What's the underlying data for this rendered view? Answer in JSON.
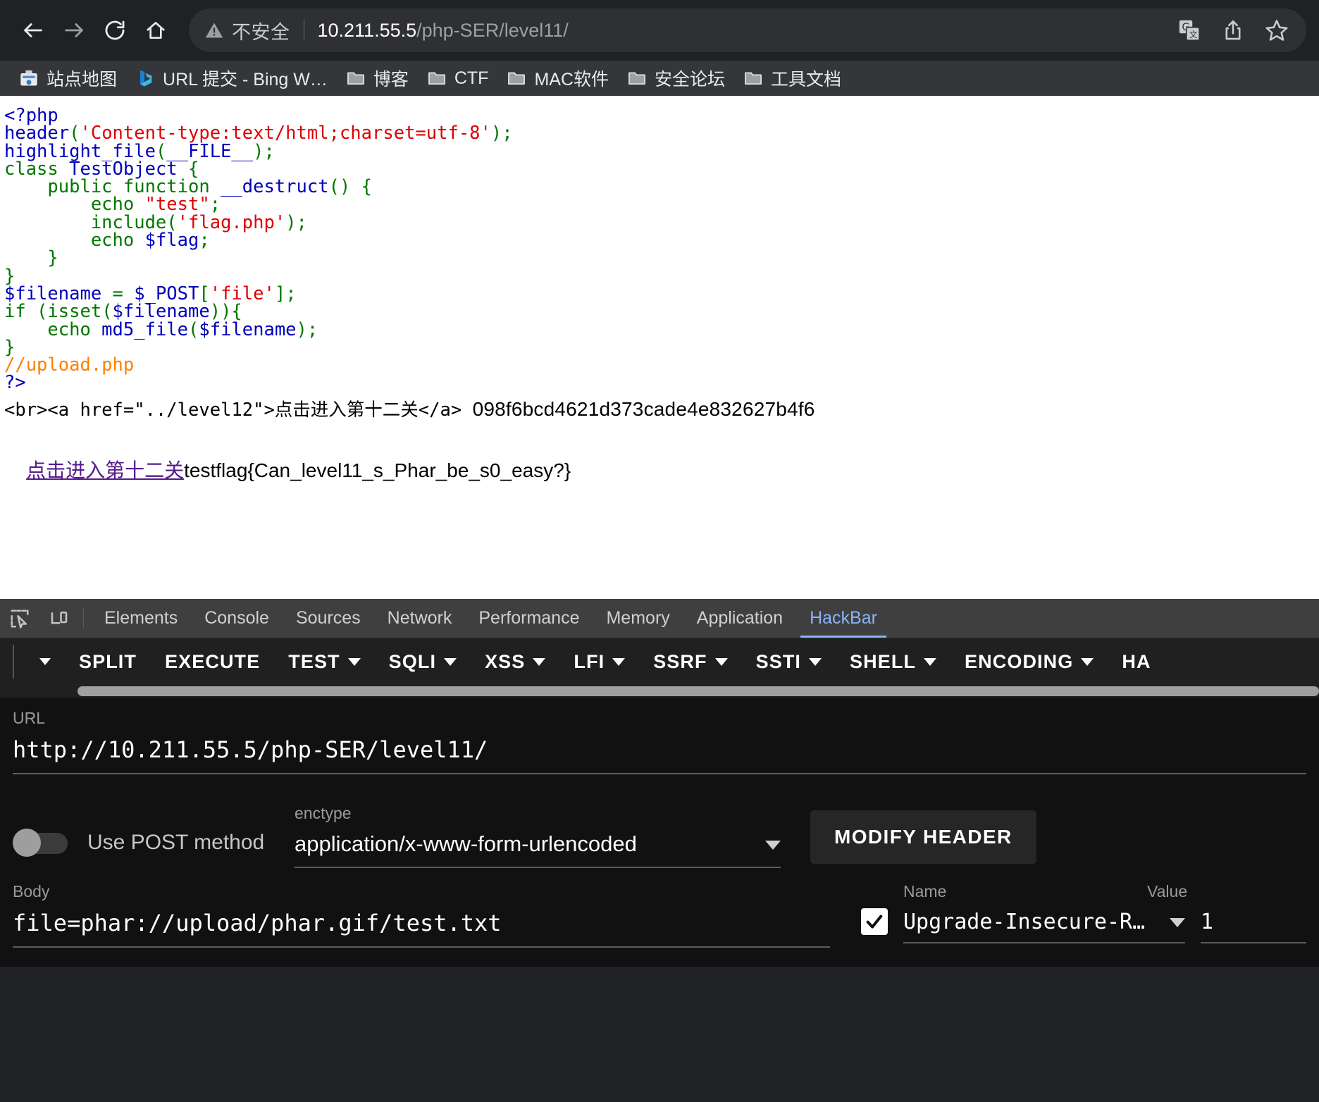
{
  "browser": {
    "nav": {
      "back": "back-arrow",
      "forward": "forward-arrow",
      "reload": "reload-arrow",
      "home": "home-house"
    },
    "omnibox": {
      "security_label": "不安全",
      "url_host": "10.211.55.5",
      "url_path": "/php-SER/level11/",
      "full_url": "10.211.55.5/php-SER/level11/",
      "actions": [
        "translate-icon",
        "share-icon",
        "bookmark-star-icon"
      ]
    },
    "bookmarks": [
      {
        "label": "站点地图",
        "icon": "sitemap-favicon"
      },
      {
        "label": "URL 提交 - Bing W…",
        "icon": "bing-favicon"
      },
      {
        "label": "博客",
        "icon": "folder-icon"
      },
      {
        "label": "CTF",
        "icon": "folder-icon"
      },
      {
        "label": "MAC软件",
        "icon": "folder-icon"
      },
      {
        "label": "安全论坛",
        "icon": "folder-icon"
      },
      {
        "label": "工具文档",
        "icon": "folder-icon"
      }
    ]
  },
  "page": {
    "source_lines": [
      [
        {
          "t": "<?php",
          "c": "d"
        }
      ],
      [
        {
          "t": "header",
          "c": "d"
        },
        {
          "t": "(",
          "c": "k"
        },
        {
          "t": "'Content-type:text/html;charset=utf-8'",
          "c": "s"
        },
        {
          "t": ");",
          "c": "k"
        }
      ],
      [
        {
          "t": "highlight_file",
          "c": "d"
        },
        {
          "t": "(",
          "c": "k"
        },
        {
          "t": "__FILE__",
          "c": "d"
        },
        {
          "t": ");",
          "c": "k"
        }
      ],
      [
        {
          "t": "class ",
          "c": "k"
        },
        {
          "t": "TestObject",
          "c": "d"
        },
        {
          "t": " {",
          "c": "k"
        }
      ],
      [
        {
          "t": "    public function ",
          "c": "k"
        },
        {
          "t": "__destruct",
          "c": "d"
        },
        {
          "t": "() {",
          "c": "k"
        }
      ],
      [
        {
          "t": "        echo ",
          "c": "k"
        },
        {
          "t": "\"test\"",
          "c": "s"
        },
        {
          "t": ";",
          "c": "k"
        }
      ],
      [
        {
          "t": "        include",
          "c": "k"
        },
        {
          "t": "(",
          "c": "k"
        },
        {
          "t": "'flag.php'",
          "c": "s"
        },
        {
          "t": ");",
          "c": "k"
        }
      ],
      [
        {
          "t": "        echo ",
          "c": "k"
        },
        {
          "t": "$flag",
          "c": "d"
        },
        {
          "t": ";",
          "c": "k"
        }
      ],
      [
        {
          "t": "    }",
          "c": "k"
        }
      ],
      [
        {
          "t": "}",
          "c": "k"
        }
      ],
      [
        {
          "t": "$filename",
          "c": "d"
        },
        {
          "t": " = ",
          "c": "k"
        },
        {
          "t": "$_POST",
          "c": "d"
        },
        {
          "t": "[",
          "c": "k"
        },
        {
          "t": "'file'",
          "c": "s"
        },
        {
          "t": "];",
          "c": "k"
        }
      ],
      [
        {
          "t": "if ",
          "c": "k"
        },
        {
          "t": "(",
          "c": "k"
        },
        {
          "t": "isset",
          "c": "k"
        },
        {
          "t": "(",
          "c": "k"
        },
        {
          "t": "$filename",
          "c": "d"
        },
        {
          "t": ")){",
          "c": "k"
        }
      ],
      [
        {
          "t": "    echo ",
          "c": "k"
        },
        {
          "t": "md5_file",
          "c": "d"
        },
        {
          "t": "(",
          "c": "k"
        },
        {
          "t": "$filename",
          "c": "d"
        },
        {
          "t": ");",
          "c": "k"
        }
      ],
      [
        {
          "t": "}",
          "c": "k"
        }
      ],
      [
        {
          "t": "//upload.php",
          "c": "c"
        }
      ],
      [
        {
          "t": "?>",
          "c": "d"
        }
      ]
    ],
    "output_raw_html": "<br><a href=\"../level12\">点击进入第十二关</a>",
    "output_md5": "098f6bcd4621d373cade4e832627b4f6",
    "output_link_text": "点击进入第十二关",
    "output_flag": "testflag{Can_level11_s_Phar_be_s0_easy?}"
  },
  "devtools": {
    "icons": [
      "inspect-element-icon",
      "device-toolbar-icon"
    ],
    "tabs": [
      {
        "label": "Elements",
        "active": false
      },
      {
        "label": "Console",
        "active": false
      },
      {
        "label": "Sources",
        "active": false
      },
      {
        "label": "Network",
        "active": false
      },
      {
        "label": "Performance",
        "active": false
      },
      {
        "label": "Memory",
        "active": false
      },
      {
        "label": "Application",
        "active": false
      },
      {
        "label": "HackBar",
        "active": true
      }
    ]
  },
  "hackbar": {
    "toolbar": [
      {
        "label": "",
        "caret": true
      },
      {
        "label": "SPLIT",
        "caret": false
      },
      {
        "label": "EXECUTE",
        "caret": false
      },
      {
        "label": "TEST",
        "caret": true
      },
      {
        "label": "SQLI",
        "caret": true
      },
      {
        "label": "XSS",
        "caret": true
      },
      {
        "label": "LFI",
        "caret": true
      },
      {
        "label": "SSRF",
        "caret": true
      },
      {
        "label": "SSTI",
        "caret": true
      },
      {
        "label": "SHELL",
        "caret": true
      },
      {
        "label": "ENCODING",
        "caret": true
      },
      {
        "label": "HA",
        "caret": false
      }
    ],
    "url_label": "URL",
    "url_value": "http://10.211.55.5/php-SER/level11/",
    "post_toggle_label": "Use POST method",
    "post_toggle_on": false,
    "enctype_label": "enctype",
    "enctype_value": "application/x-www-form-urlencoded",
    "modify_header_label": "MODIFY HEADER",
    "body_label": "Body",
    "body_value": "file=phar://upload/phar.gif/test.txt",
    "headers_table": {
      "columns": [
        "Name",
        "Value"
      ],
      "rows": [
        {
          "checked": true,
          "name": "Upgrade-Insecure-R…",
          "value": "1"
        }
      ]
    }
  },
  "colors": {
    "browser_bg": "#202124",
    "bookmarks_bg": "#35363a",
    "omnibox_bg": "#2f3034",
    "devtools_tabbar_bg": "#3f3f3f",
    "hackbar_toolbar_bg": "#202020",
    "hackbar_panel_bg": "#111111",
    "accent_tab": "#8ab4f8",
    "php_keyword": "#007700",
    "php_string": "#dd0000",
    "php_default": "#0000bb",
    "php_comment": "#ff8000",
    "link_visited": "#551a8b"
  }
}
